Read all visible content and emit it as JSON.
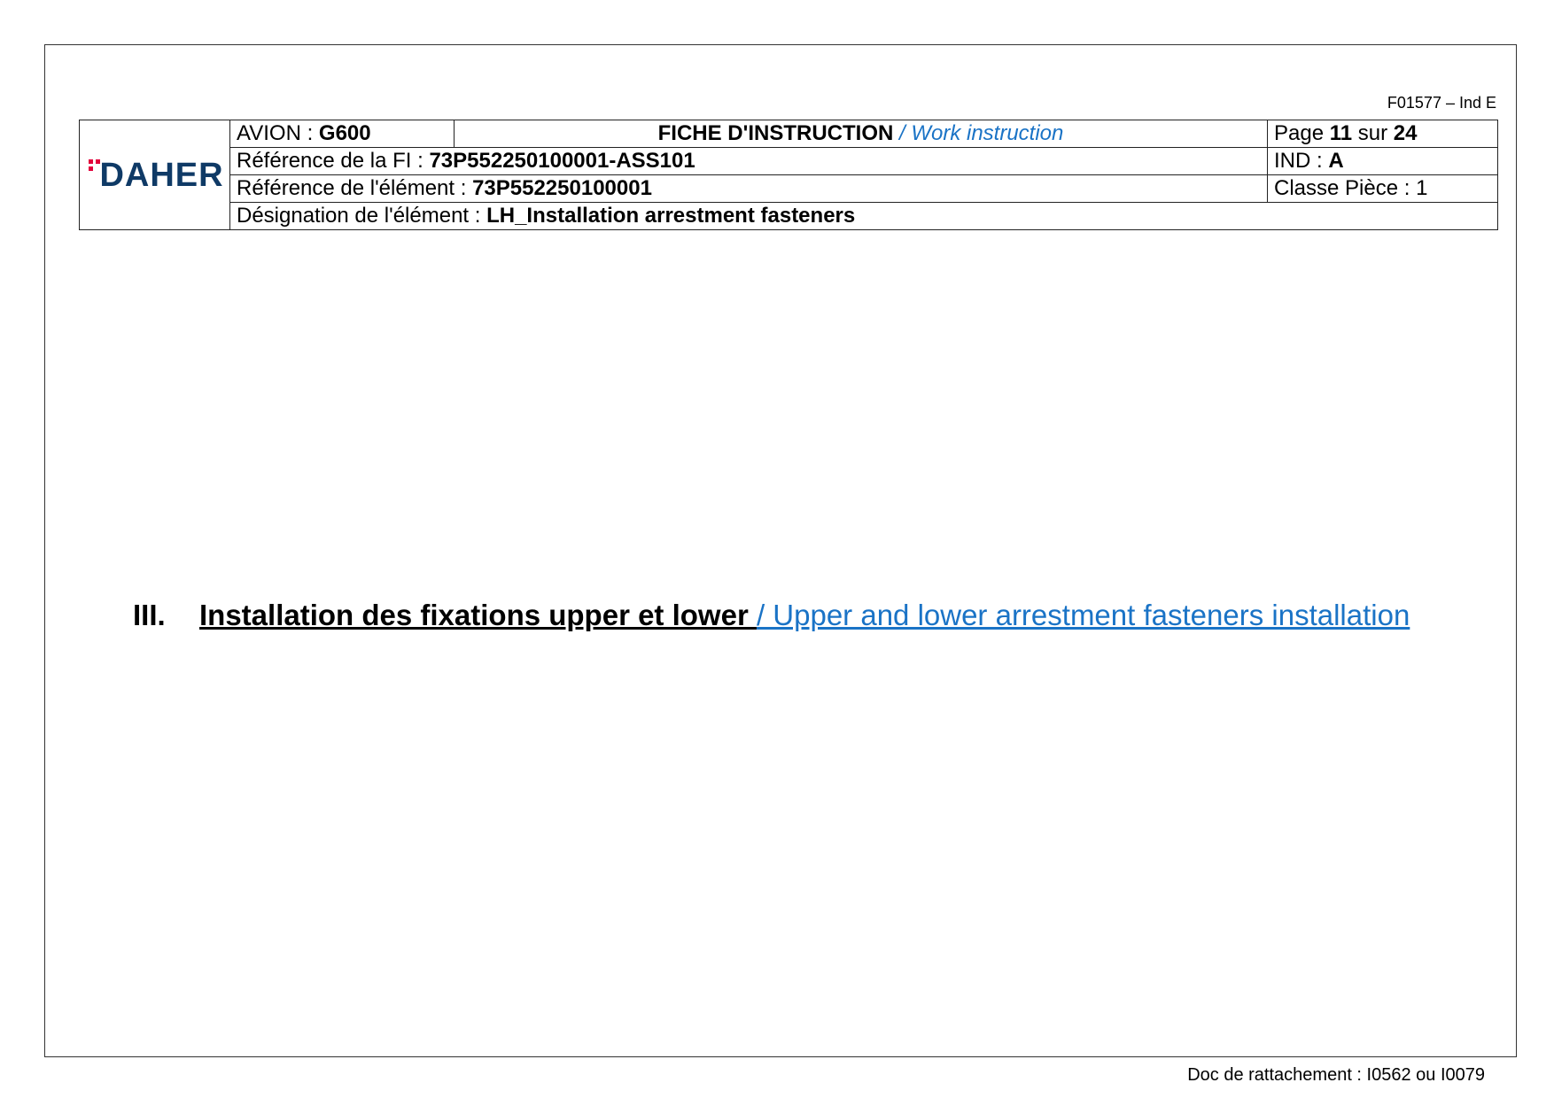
{
  "form_code": "F01577 – Ind E",
  "logo": {
    "text": "DAHER",
    "dot_color": "#e2003b",
    "text_color": "#0f3a66"
  },
  "header": {
    "avion_label": "AVION : ",
    "avion_value": "G600",
    "title_fr": "FICHE D'INSTRUCTION",
    "title_en": " / Work instruction",
    "page_label": "Page ",
    "page_current": "11",
    "page_sep": " sur ",
    "page_total": "24",
    "ref_fi_label": "Référence de la FI : ",
    "ref_fi_value": "73P552250100001-ASS101",
    "ind_label": "IND : ",
    "ind_value": "A",
    "ref_elem_label": "Référence de l'élément : ",
    "ref_elem_value": "73P552250100001",
    "classe_label": "Classe Pièce : 1",
    "designation_label": "Désignation de l'élément : ",
    "designation_value": "LH_Installation arrestment fasteners"
  },
  "section": {
    "number": "III.",
    "title_fr": "Installation des fixations upper et lower ",
    "title_en": "/ Upper and lower arrestment fasteners installation"
  },
  "footer": {
    "text": "Doc de rattachement : I0562 ou I0079"
  }
}
